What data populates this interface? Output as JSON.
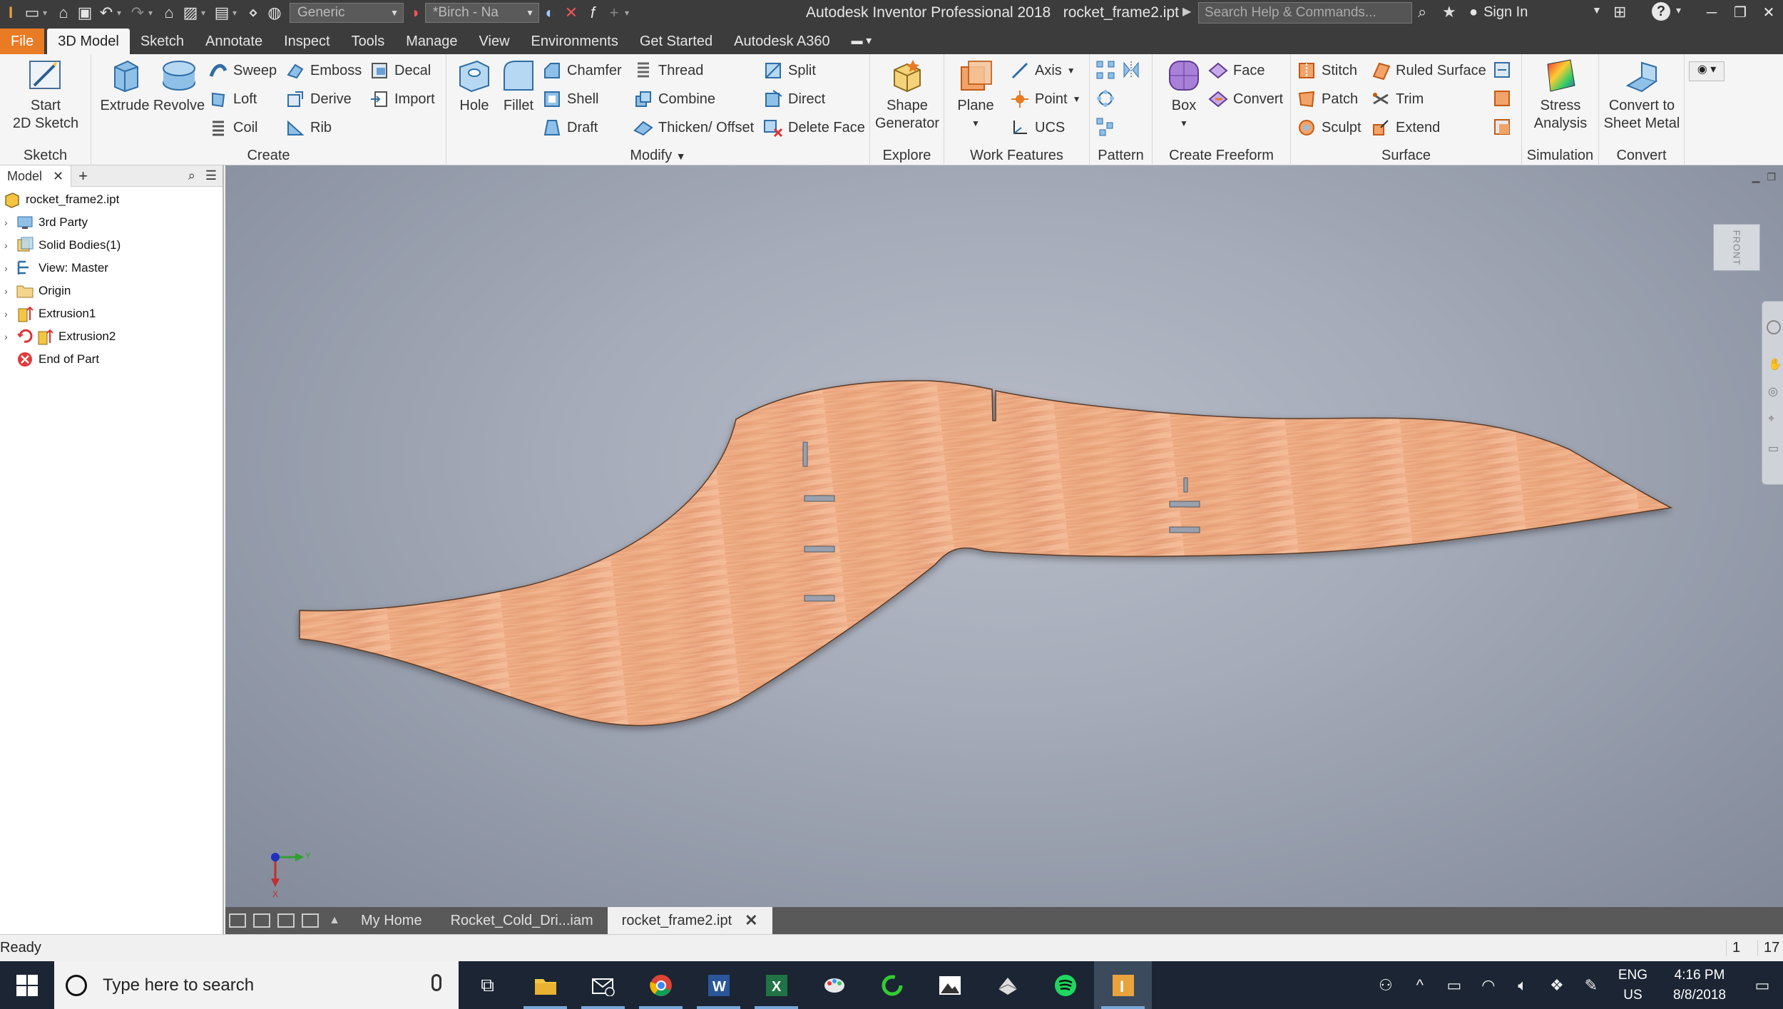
{
  "titlebar": {
    "style_combo": "Generic",
    "material_combo": "*Birch - Na",
    "app_name": "Autodesk Inventor Professional 2018",
    "file_name": "rocket_frame2.ipt",
    "search_placeholder": "Search Help & Commands...",
    "sign_in": "Sign In"
  },
  "menu": {
    "tabs": [
      "File",
      "3D Model",
      "Sketch",
      "Annotate",
      "Inspect",
      "Tools",
      "Manage",
      "View",
      "Environments",
      "Get Started",
      "Autodesk A360"
    ],
    "active": "3D Model"
  },
  "ribbon": {
    "sketch": {
      "title": "Sketch",
      "start_sketch": "Start\n2D Sketch"
    },
    "create": {
      "title": "Create",
      "extrude": "Extrude",
      "revolve": "Revolve",
      "sweep": "Sweep",
      "emboss": "Emboss",
      "decal": "Decal",
      "loft": "Loft",
      "derive": "Derive",
      "import": "Import",
      "coil": "Coil",
      "rib": "Rib"
    },
    "modify": {
      "title": "Modify",
      "hole": "Hole",
      "fillet": "Fillet",
      "chamfer": "Chamfer",
      "thread": "Thread",
      "split": "Split",
      "shell": "Shell",
      "combine": "Combine",
      "direct": "Direct",
      "draft": "Draft",
      "thicken": "Thicken/ Offset",
      "delete_face": "Delete Face"
    },
    "explore": {
      "title": "Explore",
      "shape_generator": "Shape\nGenerator"
    },
    "work": {
      "title": "Work Features",
      "plane": "Plane",
      "axis": "Axis",
      "point": "Point",
      "ucs": "UCS"
    },
    "pattern": {
      "title": "Pattern"
    },
    "freeform": {
      "title": "Create Freeform",
      "box": "Box",
      "face": "Face",
      "convert": "Convert"
    },
    "surface": {
      "title": "Surface",
      "stitch": "Stitch",
      "ruled": "Ruled Surface",
      "patch": "Patch",
      "trim": "Trim",
      "sculpt": "Sculpt",
      "extend": "Extend"
    },
    "simulation": {
      "title": "Simulation",
      "stress": "Stress\nAnalysis"
    },
    "convert": {
      "title": "Convert",
      "sheet_metal": "Convert to\nSheet Metal"
    }
  },
  "browser": {
    "tab": "Model",
    "items": [
      {
        "label": "rocket_frame2.ipt",
        "icon": "part-icon"
      },
      {
        "label": "3rd Party",
        "icon": "third-party-icon"
      },
      {
        "label": "Solid Bodies(1)",
        "icon": "solid-bodies-icon"
      },
      {
        "label": "View: Master",
        "icon": "view-icon"
      },
      {
        "label": "Origin",
        "icon": "folder-icon"
      },
      {
        "label": "Extrusion1",
        "icon": "extrusion-icon"
      },
      {
        "label": "Extrusion2",
        "icon": "extrusion-icon"
      },
      {
        "label": "End of Part",
        "icon": "end-of-part-icon"
      }
    ]
  },
  "viewport": {
    "viewcube_label": "FRONT",
    "triad": {
      "y": "Y",
      "x": "X"
    },
    "part_color": "#e9a37a"
  },
  "doctabs": {
    "tabs": [
      "My Home",
      "Rocket_Cold_Dri...iam",
      "rocket_frame2.ipt"
    ],
    "active": "rocket_frame2.ipt"
  },
  "status": {
    "text": "Ready",
    "count1": "1",
    "count2": "17"
  },
  "taskbar": {
    "search_placeholder": "Type here to search",
    "lang1": "ENG",
    "lang2": "US",
    "time": "4:16 PM",
    "date": "8/8/2018"
  }
}
